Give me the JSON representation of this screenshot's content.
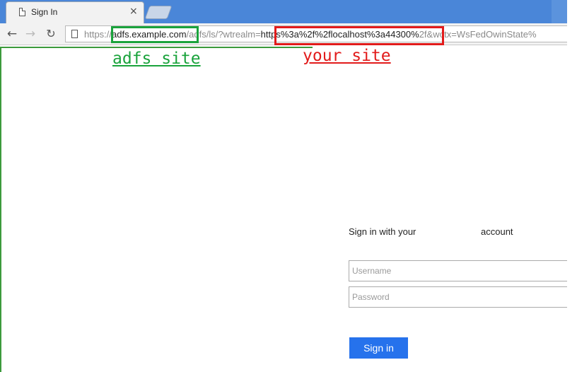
{
  "browser": {
    "tab_title": "Sign In",
    "close_glyph": "×",
    "url_scheme": "https://",
    "url_host": "adfs.example.com",
    "url_path_a": "/adfs/ls/?wtrealm=",
    "url_param": "https%3a%2f%2flocalhost%3a44300%",
    "url_path_b": "2f&wctx=WsFedOwinState%",
    "icons": [
      "page-icon",
      "back-icon",
      "forward-icon",
      "reload-icon",
      "close-icon"
    ]
  },
  "annotations": {
    "adfs_label": "adfs site",
    "your_site_label": "your site",
    "colors": {
      "green": "#1aa33c",
      "red": "#e21b1b"
    }
  },
  "signin": {
    "heading": "Sign in with your",
    "heading_suffix": "account",
    "username_placeholder": "Username",
    "password_placeholder": "Password",
    "button_label": "Sign in",
    "accent": "#2672ec"
  }
}
